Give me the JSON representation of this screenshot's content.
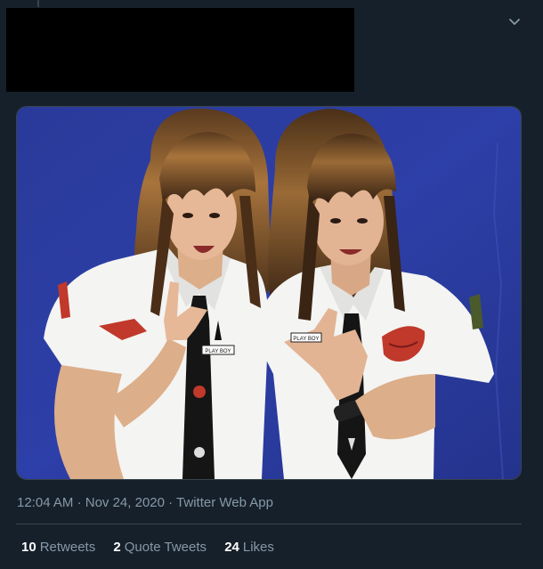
{
  "tweet": {
    "timestamp_time": "12:04 AM",
    "separator": "·",
    "timestamp_date": "Nov 24, 2020",
    "source_app": "Twitter Web App",
    "photo_patches": {
      "left_chest": "PLAY BOY",
      "right_chest": "PLAY BOY"
    }
  },
  "stats": {
    "retweets_count": "10",
    "retweets_label": "Retweets",
    "quotes_count": "2",
    "quotes_label": "Quote Tweets",
    "likes_count": "24",
    "likes_label": "Likes"
  },
  "colors": {
    "background": "#15202b",
    "secondary_text": "#8899a6",
    "primary_text": "#ffffff",
    "border": "#38444d"
  }
}
